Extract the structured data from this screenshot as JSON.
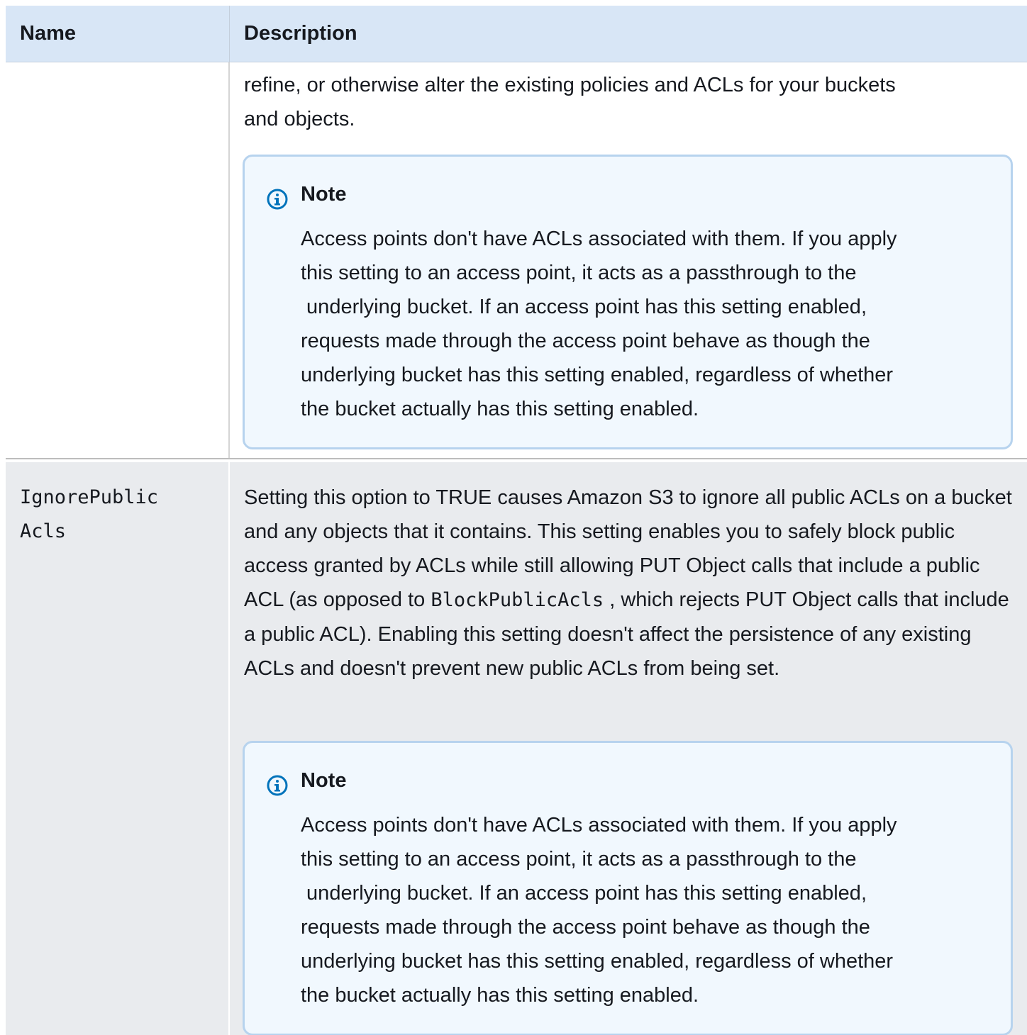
{
  "table": {
    "headers": {
      "name": "Name",
      "description": "Description"
    },
    "rows": [
      {
        "name": "",
        "description_lines": [
          "refine, or otherwise alter the  existing policies and ACLs for your buckets",
          "and objects."
        ],
        "note": {
          "icon": "info-icon",
          "title": "Note",
          "lines": [
            "Access points don't have ACLs associated with them. If you  apply",
            "this setting to an access point, it acts as a passthrough to the",
            " underlying bucket. If an access point has this setting enabled,",
            "requests  made through the access point behave as though the",
            "underlying bucket has  this setting enabled, regardless of whether",
            "the bucket actually  has this setting enabled."
          ]
        }
      },
      {
        "name": "IgnorePublicAcls",
        "description": {
          "seg1": "Setting this option to TRUE causes Amazon S3 to ignore all  public ACLs on a bucket and any objects that it contains. This  setting enables you to safely block public access granted by ACLs  while still allowing PUT Object calls that include a public ACL (as  opposed to ",
          "code": "BlockPublicAcls",
          "seg2": " , which rejects PUT Object  calls that include a public ACL). Enabling this setting doesn't  affect the persistence of any existing ACLs and doesn't prevent new  public ACLs from being set."
        },
        "note": {
          "icon": "info-icon",
          "title": "Note",
          "lines": [
            "Access points don't have ACLs associated with them. If you  apply",
            "this setting to an access point, it acts as a passthrough to the",
            " underlying bucket. If an access point has this setting enabled,",
            "requests  made through the access point behave as though the",
            "underlying bucket has  this setting enabled, regardless of whether",
            "the bucket actually  has this setting enabled."
          ]
        }
      }
    ]
  },
  "colors": {
    "header_bg": "#d8e6f6",
    "alt_row_bg": "#e9ebee",
    "note_bg": "#f1f8fe",
    "note_border": "#b7d3ee",
    "info_icon": "#0073bb"
  }
}
